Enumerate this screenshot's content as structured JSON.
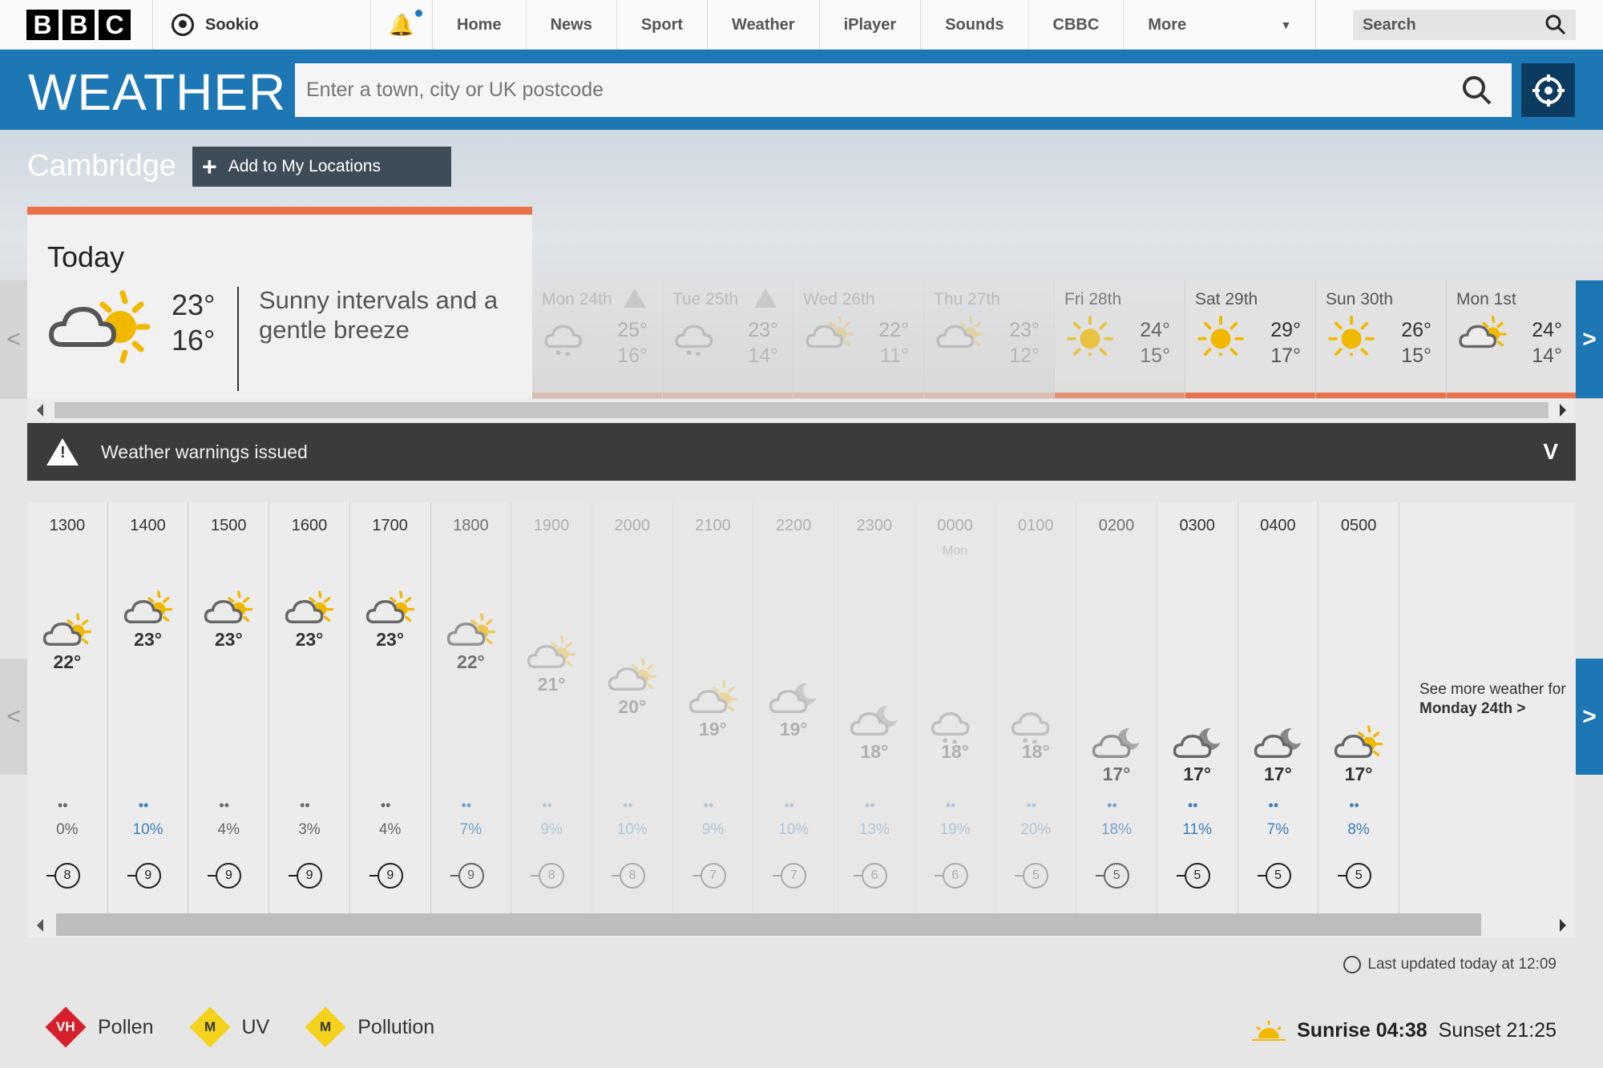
{
  "header": {
    "logo_letters": [
      "B",
      "B",
      "C"
    ],
    "account_name": "Sookio",
    "nav": [
      "Home",
      "News",
      "Sport",
      "Weather",
      "iPlayer",
      "Sounds",
      "CBBC",
      "More"
    ],
    "search_label": "Search"
  },
  "weather_bar": {
    "title": "WEATHER",
    "placeholder": "Enter a town, city or UK postcode"
  },
  "location": {
    "city": "Cambridge",
    "add_label": "Add to My Locations"
  },
  "today": {
    "label": "Today",
    "high": "23°",
    "low": "16°",
    "description": "Sunny intervals and a gentle breeze"
  },
  "days": [
    {
      "name": "Mon 24th",
      "high": "25°",
      "low": "16°",
      "warning": true,
      "icon": "cloud-rain-icon"
    },
    {
      "name": "Tue 25th",
      "high": "23°",
      "low": "14°",
      "warning": true,
      "icon": "cloud-rain-icon"
    },
    {
      "name": "Wed 26th",
      "high": "22°",
      "low": "11°",
      "warning": false,
      "icon": "sun-cloud-icon"
    },
    {
      "name": "Thu 27th",
      "high": "23°",
      "low": "12°",
      "warning": false,
      "icon": "sun-cloud-icon"
    },
    {
      "name": "Fri 28th",
      "high": "24°",
      "low": "15°",
      "warning": false,
      "icon": "sun-icon"
    },
    {
      "name": "Sat 29th",
      "high": "29°",
      "low": "17°",
      "warning": false,
      "icon": "sun-icon"
    },
    {
      "name": "Sun 30th",
      "high": "26°",
      "low": "15°",
      "warning": false,
      "icon": "sun-icon"
    },
    {
      "name": "Mon 1st",
      "high": "24°",
      "low": "14°",
      "warning": false,
      "icon": "sun-cloud-icon"
    }
  ],
  "warnings": {
    "label": "Weather warnings issued"
  },
  "hours": [
    {
      "time": "1300",
      "sub": "",
      "temp": "22°",
      "rain": "0%",
      "wind": "8",
      "icon": "sun-cloud"
    },
    {
      "time": "1400",
      "sub": "",
      "temp": "23°",
      "rain": "10%",
      "wind": "9",
      "icon": "sun-cloud"
    },
    {
      "time": "1500",
      "sub": "",
      "temp": "23°",
      "rain": "4%",
      "wind": "9",
      "icon": "sun-cloud"
    },
    {
      "time": "1600",
      "sub": "",
      "temp": "23°",
      "rain": "3%",
      "wind": "9",
      "icon": "sun-cloud"
    },
    {
      "time": "1700",
      "sub": "",
      "temp": "23°",
      "rain": "4%",
      "wind": "9",
      "icon": "sun-cloud"
    },
    {
      "time": "1800",
      "sub": "",
      "temp": "22°",
      "rain": "7%",
      "wind": "9",
      "icon": "sun-cloud"
    },
    {
      "time": "1900",
      "sub": "",
      "temp": "21°",
      "rain": "9%",
      "wind": "8",
      "icon": "sun-cloud"
    },
    {
      "time": "2000",
      "sub": "",
      "temp": "20°",
      "rain": "10%",
      "wind": "8",
      "icon": "sun-cloud"
    },
    {
      "time": "2100",
      "sub": "",
      "temp": "19°",
      "rain": "9%",
      "wind": "7",
      "icon": "sun-cloud"
    },
    {
      "time": "2200",
      "sub": "",
      "temp": "19°",
      "rain": "10%",
      "wind": "7",
      "icon": "moon-cloud"
    },
    {
      "time": "2300",
      "sub": "",
      "temp": "18°",
      "rain": "13%",
      "wind": "6",
      "icon": "moon-cloud"
    },
    {
      "time": "0000",
      "sub": "Mon",
      "temp": "18°",
      "rain": "19%",
      "wind": "6",
      "icon": "cloud-rain"
    },
    {
      "time": "0100",
      "sub": "",
      "temp": "18°",
      "rain": "20%",
      "wind": "5",
      "icon": "cloud-rain"
    },
    {
      "time": "0200",
      "sub": "",
      "temp": "17°",
      "rain": "18%",
      "wind": "5",
      "icon": "moon-cloud"
    },
    {
      "time": "0300",
      "sub": "",
      "temp": "17°",
      "rain": "11%",
      "wind": "5",
      "icon": "moon-cloud"
    },
    {
      "time": "0400",
      "sub": "",
      "temp": "17°",
      "rain": "7%",
      "wind": "5",
      "icon": "moon-cloud"
    },
    {
      "time": "0500",
      "sub": "",
      "temp": "17°",
      "rain": "8%",
      "wind": "5",
      "icon": "sun-cloud"
    }
  ],
  "see_more": {
    "line1": "See more weather for",
    "line2": "Monday 24th"
  },
  "updated": "Last updated today at 12:09",
  "environment": [
    {
      "label": "Pollen",
      "level": "VH",
      "color": "#d6202b",
      "text_color": "#ffffff"
    },
    {
      "label": "UV",
      "level": "M",
      "color": "#f4d21c",
      "text_color": "#333333"
    },
    {
      "label": "Pollution",
      "level": "M",
      "color": "#f4d21c",
      "text_color": "#333333"
    }
  ],
  "sun": {
    "sunrise": "Sunrise 04:38",
    "sunset": "Sunset 21:25"
  },
  "colors": {
    "brand_blue": "#1d77b4",
    "temp_strip": "#e8734a",
    "sun": "#f1b800",
    "rain": "#3d7fb8"
  }
}
